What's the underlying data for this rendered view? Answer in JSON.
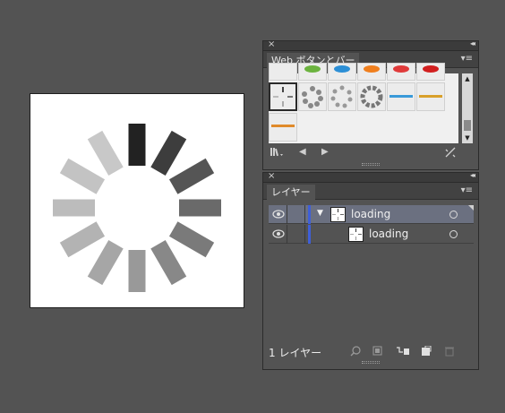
{
  "artboard": {
    "spinner_colors": [
      "#222222",
      "#3d3d3d",
      "#555555",
      "#6a6a6a",
      "#7a7a7a",
      "#888888",
      "#999999",
      "#a6a6a6",
      "#b3b3b3",
      "#bcbcbc",
      "#c3c3c3",
      "#c8c8c8"
    ]
  },
  "web_buttons_panel": {
    "tab_label": "Web ボタンとバー",
    "close_icon": "×",
    "collapse_icon": "◂◂",
    "menu_icon": "▾≡"
  },
  "layers_panel": {
    "tab_label": "レイヤー",
    "close_icon": "×",
    "collapse_icon": "◂◂",
    "menu_icon": "▾≡",
    "rows": [
      {
        "name": "loading",
        "expand_arrow": "▼"
      },
      {
        "name": "loading"
      }
    ],
    "layer_count": "1 レイヤー"
  },
  "colors": {
    "layer_color": "#3f5fd8",
    "selected_row": "#6b7080"
  }
}
